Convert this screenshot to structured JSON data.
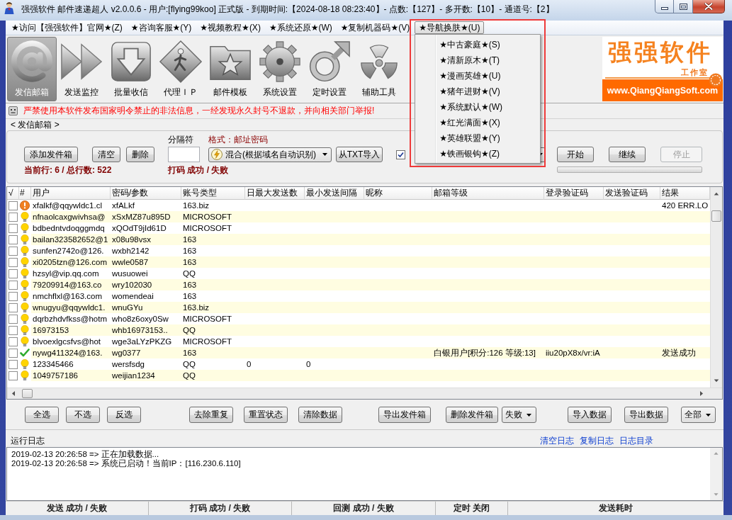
{
  "window": {
    "title": "强强软件 邮件速递超人 v2.0.0.6 - 用户:[flying99koo] 正式版 - 到期时间:【2024-08-18 08:23:40】- 点数:【127】- 多开数:【10】- 通道号:【2】"
  },
  "menu_bar": {
    "items": [
      {
        "label": "★访问【强强软件】官网★(Z)",
        "selected": false
      },
      {
        "label": "★咨询客服★(Y)",
        "selected": false
      },
      {
        "label": "★视频教程★(X)",
        "selected": false
      },
      {
        "label": "★系统还原★(W)",
        "selected": false
      },
      {
        "label": "★复制机器码★(V)",
        "selected": false
      },
      {
        "label": "★导航换肤★(U)",
        "selected": true
      }
    ]
  },
  "dropdown_menu": {
    "highlighted": true,
    "items": [
      "★中古豪庭★(S)",
      "★清新原木★(T)",
      "★漫画英雄★(U)",
      "★猪年进财★(V)",
      "★系统默认★(W)",
      "★红光满面★(X)",
      "★英雄联盟★(Y)",
      "★铁画银钩★(Z)"
    ]
  },
  "toolbar": {
    "items": [
      {
        "label": "发信邮箱",
        "selected": true
      },
      {
        "label": "发送监控",
        "selected": false
      },
      {
        "label": "批量收信",
        "selected": false
      },
      {
        "label": "代理ＩＰ",
        "selected": false
      },
      {
        "label": "邮件模板",
        "selected": false
      },
      {
        "label": "系统设置",
        "selected": false
      },
      {
        "label": "定时设置",
        "selected": false
      },
      {
        "label": "辅助工具",
        "selected": false
      }
    ]
  },
  "logo": {
    "title": "强强软件",
    "subtitle": "工作室",
    "url": "www.QiangQiangSoft.com"
  },
  "warning": "严禁使用本软件发布国家明令禁止的非法信息，一经发现永久封号不退款，并向相关部门举报!",
  "send_panel": {
    "title": "< 发信邮箱 >",
    "buttons": [
      "添加发件箱",
      "清空",
      "删除"
    ],
    "separator_label": "分隔符",
    "format_label": "格式：邮址密码",
    "mode_select": "混合(根据域名自动识别)",
    "import_button": "从TXT导入",
    "option_checkbox": {
      "checked": true
    },
    "action_buttons": [
      {
        "label": "开始",
        "disabled": false
      },
      {
        "label": "继续",
        "disabled": false
      },
      {
        "label": "停止",
        "disabled": true
      }
    ],
    "progress": {
      "level": 0
    },
    "current_row": "当前行: 6 / 总行数: 522",
    "captcha_stats": "打码 成功 / 失败"
  },
  "table": {
    "columns": [
      "√",
      "#",
      "用户",
      "密码/参数",
      "账号类型",
      "日最大发送数",
      "最小发送间隔",
      "昵称",
      "邮箱等级",
      "登录验证码",
      "发送验证码",
      "结果"
    ],
    "rows": [
      {
        "checked": false,
        "kind": "error",
        "user": "xfalkf@qqywldc1.cl",
        "password": "xfALkf",
        "account_type": "163.biz",
        "result": "420 ERR.LO"
      },
      {
        "checked": false,
        "kind": "waiting",
        "user": "nfnaolcaxgwivhsa@",
        "password": "xSxMZ87u895D",
        "account_type": "MICROSOFT"
      },
      {
        "checked": false,
        "kind": "waiting",
        "user": "bdbedntvdoqggmdq",
        "password": "xQOdT9jId61D",
        "account_type": "MICROSOFT"
      },
      {
        "checked": false,
        "kind": "waiting",
        "user": "bailan323582652@1",
        "password": "x08u98vsx",
        "account_type": "163"
      },
      {
        "checked": false,
        "kind": "waiting",
        "user": "sunfen2742o@126.",
        "password": "wxbh2142",
        "account_type": "163"
      },
      {
        "checked": false,
        "kind": "waiting",
        "user": "xi0205tzn@126.com",
        "password": "wwle0587",
        "account_type": "163"
      },
      {
        "checked": false,
        "kind": "waiting",
        "user": "hzsyl@vip.qq.com",
        "password": "wusuowei",
        "account_type": "QQ"
      },
      {
        "checked": false,
        "kind": "waiting",
        "user": "79209914@163.co",
        "password": "wry102030",
        "account_type": "163"
      },
      {
        "checked": false,
        "kind": "waiting",
        "user": "nmchflxl@163.com",
        "password": "womendeai",
        "account_type": "163"
      },
      {
        "checked": false,
        "kind": "waiting",
        "user": "wnugyu@qqywldc1.",
        "password": "wnuGYu",
        "account_type": "163.biz"
      },
      {
        "checked": false,
        "kind": "waiting",
        "user": "dqrbzhdvfkss@hotm",
        "password": "who8z6oxy0Sw",
        "account_type": "MICROSOFT"
      },
      {
        "checked": false,
        "kind": "waiting",
        "user": "16973153",
        "password": "whb16973153..",
        "account_type": "QQ"
      },
      {
        "checked": false,
        "kind": "waiting",
        "user": "blvoexlgcsfvs@hot",
        "password": "wge3aLYzPKZG",
        "account_type": "MICROSOFT"
      },
      {
        "checked": false,
        "kind": "success",
        "user": "nywg411324@163.",
        "password": "wg0377",
        "account_type": "163",
        "mailbox_level": "白银用户[积分:126 等级:13]",
        "login_captcha": "iiu20pX8x/vr:iA",
        "result": "发送成功"
      },
      {
        "checked": false,
        "kind": "waiting",
        "user": "123345466",
        "password": "wersfsdg",
        "account_type": "QQ",
        "daily_max": "0",
        "min_interval": "0"
      },
      {
        "checked": false,
        "kind": "waiting",
        "user": "1049757186",
        "password": "weijian1234",
        "account_type": "QQ"
      }
    ]
  },
  "bottom_bar": {
    "groups": [
      [
        {
          "kind": "button",
          "label": "全选"
        },
        {
          "kind": "button",
          "label": "不选"
        },
        {
          "kind": "button",
          "label": "反选"
        }
      ],
      [
        {
          "kind": "button",
          "label": "去除重复"
        },
        {
          "kind": "button",
          "label": "重置状态"
        },
        {
          "kind": "button",
          "label": "清除数据"
        }
      ],
      [
        {
          "kind": "button",
          "label": "导出发件箱"
        }
      ],
      [
        {
          "kind": "button",
          "label": "删除发件箱"
        },
        {
          "kind": "select",
          "value": "失败"
        }
      ],
      [
        {
          "kind": "button",
          "label": "导入数据"
        },
        {
          "kind": "button",
          "label": "导出数据"
        },
        {
          "kind": "select",
          "value": "全部"
        }
      ]
    ]
  },
  "log": {
    "title": "运行日志",
    "links": [
      "清空日志",
      "复制日志",
      "日志目录"
    ],
    "lines": [
      "2019-02-13 20:26:58 => 正在加载数据...",
      "2019-02-13 20:26:58 => 系统已启动！当前IP：[116.230.6.110]"
    ]
  },
  "status_bar": [
    "发送 成功 / 失败",
    "打码 成功 / 失败",
    "回测 成功 / 失败",
    "定时 关闭",
    "发送耗时"
  ]
}
